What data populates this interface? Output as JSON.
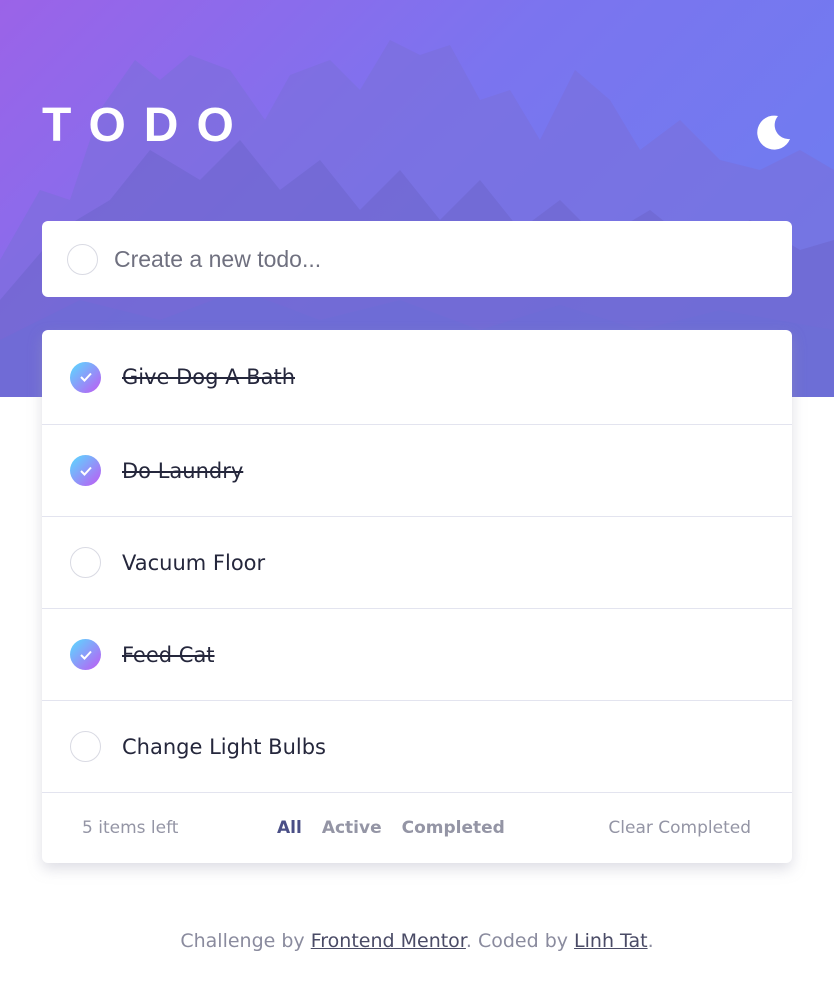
{
  "header": {
    "title": "TODO",
    "theme_icon": "moon-icon"
  },
  "new_todo": {
    "placeholder": "Create a new todo...",
    "value": ""
  },
  "todos": [
    {
      "label": "Give Dog A Bath",
      "completed": true
    },
    {
      "label": "Do Laundry",
      "completed": true
    },
    {
      "label": "Vacuum Floor",
      "completed": false
    },
    {
      "label": "Feed Cat",
      "completed": true
    },
    {
      "label": "Change Light Bulbs",
      "completed": false
    }
  ],
  "footer": {
    "items_left": "5 items left",
    "filters": [
      "All",
      "Active",
      "Completed"
    ],
    "active_filter": "All",
    "clear_label": "Clear Completed"
  },
  "credit": {
    "prefix": "Challenge by ",
    "link1": "Frontend Mentor",
    "middle": ". Coded by ",
    "link2": "Linh Tat",
    "suffix": "."
  },
  "colors": {
    "gradient_start": "#57ddff",
    "gradient_end": "#c058f3",
    "active_filter": "#4a4f86",
    "muted": "#9495a5"
  }
}
